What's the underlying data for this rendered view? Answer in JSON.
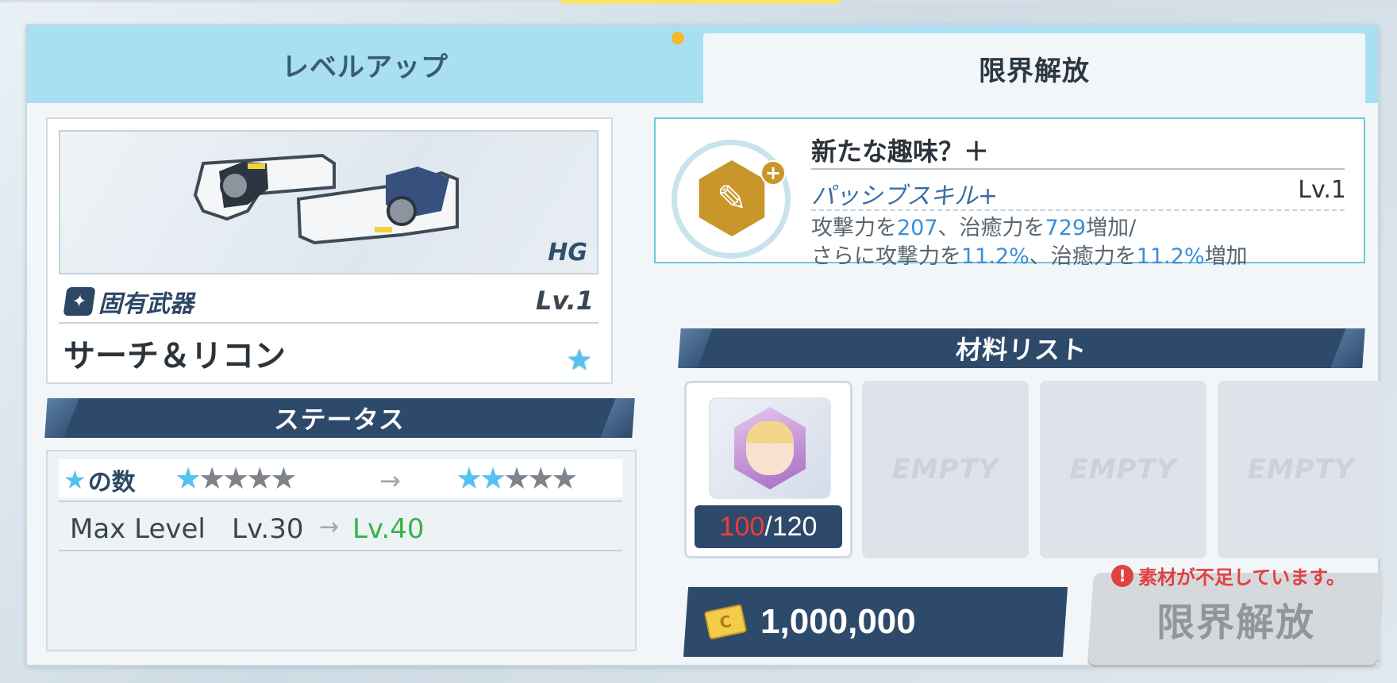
{
  "tabs": {
    "level_up": "レベルアップ",
    "limit_break": "限界解放"
  },
  "weapon": {
    "grade": "HG",
    "type_label": "固有武器",
    "level": "Lv.1",
    "name": "サーチ＆リコン",
    "type_icon": "rifle-icon"
  },
  "status": {
    "title": "ステータス",
    "star_label": "の数",
    "stars_from": 1,
    "stars_to": 2,
    "stars_total": 5,
    "max_level_label": "Max Level",
    "level_from": "Lv.30",
    "level_to": "Lv.40"
  },
  "skill": {
    "title": "新たな趣味？＋",
    "type": "パッシブスキル+",
    "level": "Lv.1",
    "desc_line1_a": "攻撃力を",
    "desc_line1_v1": "207",
    "desc_line1_b": "、治癒力を",
    "desc_line1_v2": "729",
    "desc_line1_c": "増加/",
    "desc_line2_a": "さらに攻撃力を",
    "desc_line2_v1": "11.2%",
    "desc_line2_b": "、治癒力を",
    "desc_line2_v2": "11.2%",
    "desc_line2_c": "増加"
  },
  "materials": {
    "title": "材料リスト",
    "owned": "100",
    "required": "/120",
    "empty_label": "EMPTY"
  },
  "cost": {
    "value": "1,000,000",
    "icon": "credit-card-icon"
  },
  "warning": {
    "text": "素材が不足しています。"
  },
  "action": {
    "label": "限界解放"
  },
  "colors": {
    "tab_inactive": "#a8dff2",
    "banner": "#2e4a6b",
    "accent_blue": "#3a8fd9",
    "level_up_green": "#36b24a",
    "shortage_red": "#ef3b3b"
  }
}
